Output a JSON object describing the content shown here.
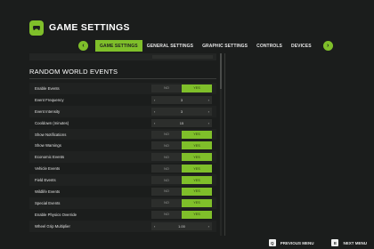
{
  "header": {
    "title": "GAME SETTINGS",
    "logo_icon": "controller-icon"
  },
  "tabs": {
    "prev_label": "‹",
    "next_label": "›",
    "items": [
      {
        "label": "GAME SETTINGS",
        "active": true
      },
      {
        "label": "GENERAL SETTINGS",
        "active": false
      },
      {
        "label": "GRAPHIC SETTINGS",
        "active": false
      },
      {
        "label": "CONTROLS",
        "active": false
      },
      {
        "label": "DEVICES",
        "active": false
      }
    ]
  },
  "section": {
    "title": "RANDOM WORLD EVENTS"
  },
  "options": {
    "no": "NO",
    "yes": "YES"
  },
  "rows": [
    {
      "label": "Enable Events",
      "type": "toggle",
      "value": "YES"
    },
    {
      "label": "Event Frequency",
      "type": "select",
      "value": "3"
    },
    {
      "label": "Event Intensity",
      "type": "select",
      "value": "3"
    },
    {
      "label": "Cooldown (minutes)",
      "type": "select",
      "value": "15"
    },
    {
      "label": "Show Notifications",
      "type": "toggle",
      "value": "YES"
    },
    {
      "label": "Show Warnings",
      "type": "toggle",
      "value": "YES"
    },
    {
      "label": "Economic Events",
      "type": "toggle",
      "value": "YES"
    },
    {
      "label": "Vehicle Events",
      "type": "toggle",
      "value": "YES"
    },
    {
      "label": "Field Events",
      "type": "toggle",
      "value": "YES"
    },
    {
      "label": "Wildlife Events",
      "type": "toggle",
      "value": "YES"
    },
    {
      "label": "Special Events",
      "type": "toggle",
      "value": "YES"
    },
    {
      "label": "Enable Physics Override",
      "type": "toggle",
      "value": "YES"
    },
    {
      "label": "Wheel Grip Multiplier",
      "type": "select",
      "value": "1.00"
    }
  ],
  "footer": {
    "previous_key": "Q",
    "previous_label": "PREVIOUS MENU",
    "next_key": "E",
    "next_label": "NEXT MENU"
  },
  "colors": {
    "accent": "#7fbf2a",
    "background": "#1b1d1c",
    "row_alt": "#202221"
  }
}
